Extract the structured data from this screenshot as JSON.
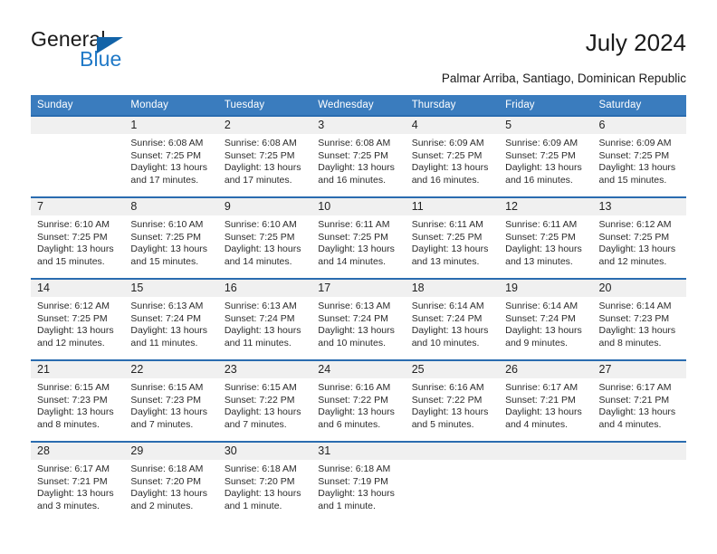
{
  "brand": {
    "name_top": "General",
    "name_bottom": "Blue",
    "triangle_icon": "brand-triangle-icon",
    "accent_color": "#1263a8",
    "blue_text_color": "#2079c7"
  },
  "header": {
    "title": "July 2024",
    "location": "Palmar Arriba, Santiago, Dominican Republic"
  },
  "colors": {
    "header_row_bg": "#3a7cbe",
    "row_divider": "#2a6cb0",
    "date_band_bg": "#f0f0f0",
    "text": "#2b2b2b"
  },
  "weekdays": [
    "Sunday",
    "Monday",
    "Tuesday",
    "Wednesday",
    "Thursday",
    "Friday",
    "Saturday"
  ],
  "weeks": [
    [
      {
        "day": ""
      },
      {
        "day": "1",
        "sunrise": "Sunrise: 6:08 AM",
        "sunset": "Sunset: 7:25 PM",
        "daylight": "Daylight: 13 hours and 17 minutes."
      },
      {
        "day": "2",
        "sunrise": "Sunrise: 6:08 AM",
        "sunset": "Sunset: 7:25 PM",
        "daylight": "Daylight: 13 hours and 17 minutes."
      },
      {
        "day": "3",
        "sunrise": "Sunrise: 6:08 AM",
        "sunset": "Sunset: 7:25 PM",
        "daylight": "Daylight: 13 hours and 16 minutes."
      },
      {
        "day": "4",
        "sunrise": "Sunrise: 6:09 AM",
        "sunset": "Sunset: 7:25 PM",
        "daylight": "Daylight: 13 hours and 16 minutes."
      },
      {
        "day": "5",
        "sunrise": "Sunrise: 6:09 AM",
        "sunset": "Sunset: 7:25 PM",
        "daylight": "Daylight: 13 hours and 16 minutes."
      },
      {
        "day": "6",
        "sunrise": "Sunrise: 6:09 AM",
        "sunset": "Sunset: 7:25 PM",
        "daylight": "Daylight: 13 hours and 15 minutes."
      }
    ],
    [
      {
        "day": "7",
        "sunrise": "Sunrise: 6:10 AM",
        "sunset": "Sunset: 7:25 PM",
        "daylight": "Daylight: 13 hours and 15 minutes."
      },
      {
        "day": "8",
        "sunrise": "Sunrise: 6:10 AM",
        "sunset": "Sunset: 7:25 PM",
        "daylight": "Daylight: 13 hours and 15 minutes."
      },
      {
        "day": "9",
        "sunrise": "Sunrise: 6:10 AM",
        "sunset": "Sunset: 7:25 PM",
        "daylight": "Daylight: 13 hours and 14 minutes."
      },
      {
        "day": "10",
        "sunrise": "Sunrise: 6:11 AM",
        "sunset": "Sunset: 7:25 PM",
        "daylight": "Daylight: 13 hours and 14 minutes."
      },
      {
        "day": "11",
        "sunrise": "Sunrise: 6:11 AM",
        "sunset": "Sunset: 7:25 PM",
        "daylight": "Daylight: 13 hours and 13 minutes."
      },
      {
        "day": "12",
        "sunrise": "Sunrise: 6:11 AM",
        "sunset": "Sunset: 7:25 PM",
        "daylight": "Daylight: 13 hours and 13 minutes."
      },
      {
        "day": "13",
        "sunrise": "Sunrise: 6:12 AM",
        "sunset": "Sunset: 7:25 PM",
        "daylight": "Daylight: 13 hours and 12 minutes."
      }
    ],
    [
      {
        "day": "14",
        "sunrise": "Sunrise: 6:12 AM",
        "sunset": "Sunset: 7:25 PM",
        "daylight": "Daylight: 13 hours and 12 minutes."
      },
      {
        "day": "15",
        "sunrise": "Sunrise: 6:13 AM",
        "sunset": "Sunset: 7:24 PM",
        "daylight": "Daylight: 13 hours and 11 minutes."
      },
      {
        "day": "16",
        "sunrise": "Sunrise: 6:13 AM",
        "sunset": "Sunset: 7:24 PM",
        "daylight": "Daylight: 13 hours and 11 minutes."
      },
      {
        "day": "17",
        "sunrise": "Sunrise: 6:13 AM",
        "sunset": "Sunset: 7:24 PM",
        "daylight": "Daylight: 13 hours and 10 minutes."
      },
      {
        "day": "18",
        "sunrise": "Sunrise: 6:14 AM",
        "sunset": "Sunset: 7:24 PM",
        "daylight": "Daylight: 13 hours and 10 minutes."
      },
      {
        "day": "19",
        "sunrise": "Sunrise: 6:14 AM",
        "sunset": "Sunset: 7:24 PM",
        "daylight": "Daylight: 13 hours and 9 minutes."
      },
      {
        "day": "20",
        "sunrise": "Sunrise: 6:14 AM",
        "sunset": "Sunset: 7:23 PM",
        "daylight": "Daylight: 13 hours and 8 minutes."
      }
    ],
    [
      {
        "day": "21",
        "sunrise": "Sunrise: 6:15 AM",
        "sunset": "Sunset: 7:23 PM",
        "daylight": "Daylight: 13 hours and 8 minutes."
      },
      {
        "day": "22",
        "sunrise": "Sunrise: 6:15 AM",
        "sunset": "Sunset: 7:23 PM",
        "daylight": "Daylight: 13 hours and 7 minutes."
      },
      {
        "day": "23",
        "sunrise": "Sunrise: 6:15 AM",
        "sunset": "Sunset: 7:22 PM",
        "daylight": "Daylight: 13 hours and 7 minutes."
      },
      {
        "day": "24",
        "sunrise": "Sunrise: 6:16 AM",
        "sunset": "Sunset: 7:22 PM",
        "daylight": "Daylight: 13 hours and 6 minutes."
      },
      {
        "day": "25",
        "sunrise": "Sunrise: 6:16 AM",
        "sunset": "Sunset: 7:22 PM",
        "daylight": "Daylight: 13 hours and 5 minutes."
      },
      {
        "day": "26",
        "sunrise": "Sunrise: 6:17 AM",
        "sunset": "Sunset: 7:21 PM",
        "daylight": "Daylight: 13 hours and 4 minutes."
      },
      {
        "day": "27",
        "sunrise": "Sunrise: 6:17 AM",
        "sunset": "Sunset: 7:21 PM",
        "daylight": "Daylight: 13 hours and 4 minutes."
      }
    ],
    [
      {
        "day": "28",
        "sunrise": "Sunrise: 6:17 AM",
        "sunset": "Sunset: 7:21 PM",
        "daylight": "Daylight: 13 hours and 3 minutes."
      },
      {
        "day": "29",
        "sunrise": "Sunrise: 6:18 AM",
        "sunset": "Sunset: 7:20 PM",
        "daylight": "Daylight: 13 hours and 2 minutes."
      },
      {
        "day": "30",
        "sunrise": "Sunrise: 6:18 AM",
        "sunset": "Sunset: 7:20 PM",
        "daylight": "Daylight: 13 hours and 1 minute."
      },
      {
        "day": "31",
        "sunrise": "Sunrise: 6:18 AM",
        "sunset": "Sunset: 7:19 PM",
        "daylight": "Daylight: 13 hours and 1 minute."
      },
      {
        "day": ""
      },
      {
        "day": ""
      },
      {
        "day": ""
      }
    ]
  ]
}
